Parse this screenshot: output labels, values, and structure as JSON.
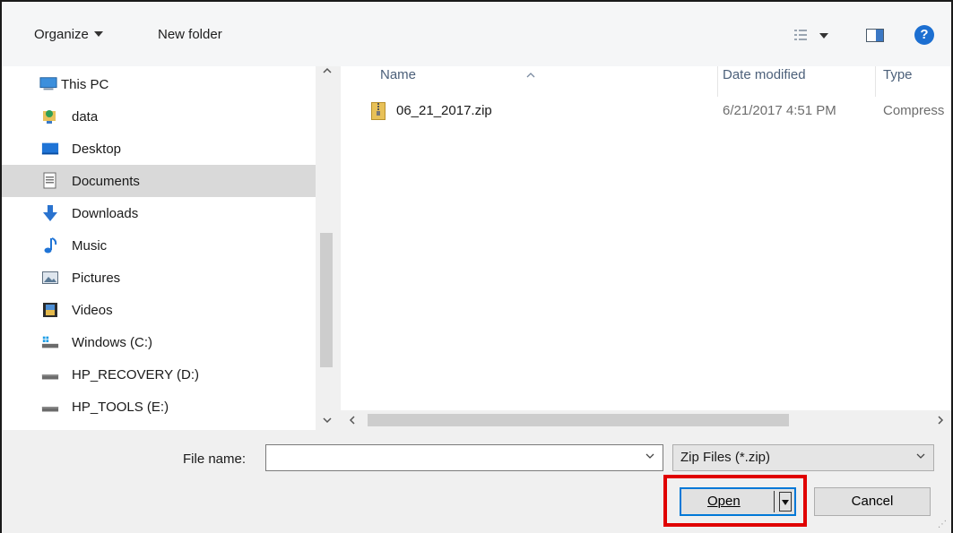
{
  "toolbar": {
    "organize_label": "Organize",
    "new_folder_label": "New folder",
    "help_label": "?"
  },
  "nav": {
    "items": [
      {
        "label": "This PC",
        "icon": "computer-icon"
      },
      {
        "label": "data",
        "icon": "network-user-folder-icon"
      },
      {
        "label": "Desktop",
        "icon": "desktop-folder-icon"
      },
      {
        "label": "Documents",
        "icon": "documents-folder-icon",
        "selected": true
      },
      {
        "label": "Downloads",
        "icon": "download-arrow-icon"
      },
      {
        "label": "Music",
        "icon": "music-note-icon"
      },
      {
        "label": "Pictures",
        "icon": "pictures-folder-icon"
      },
      {
        "label": "Videos",
        "icon": "videos-folder-icon"
      },
      {
        "label": "Windows (C:)",
        "icon": "windows-drive-icon"
      },
      {
        "label": "HP_RECOVERY (D:)",
        "icon": "drive-icon"
      },
      {
        "label": "HP_TOOLS (E:)",
        "icon": "drive-icon"
      }
    ]
  },
  "list": {
    "columns": {
      "name": "Name",
      "date": "Date modified",
      "type": "Type"
    },
    "files": [
      {
        "name": "06_21_2017.zip",
        "date": "6/21/2017 4:51 PM",
        "type": "Compress"
      }
    ]
  },
  "bottom": {
    "file_name_label": "File name:",
    "file_name_value": "",
    "filter_value": "Zip Files (*.zip)",
    "open_label": "Open",
    "cancel_label": "Cancel"
  },
  "colors": {
    "highlight": "#e00000",
    "accent": "#0078d7",
    "selected_row": "#d9d9d9"
  }
}
